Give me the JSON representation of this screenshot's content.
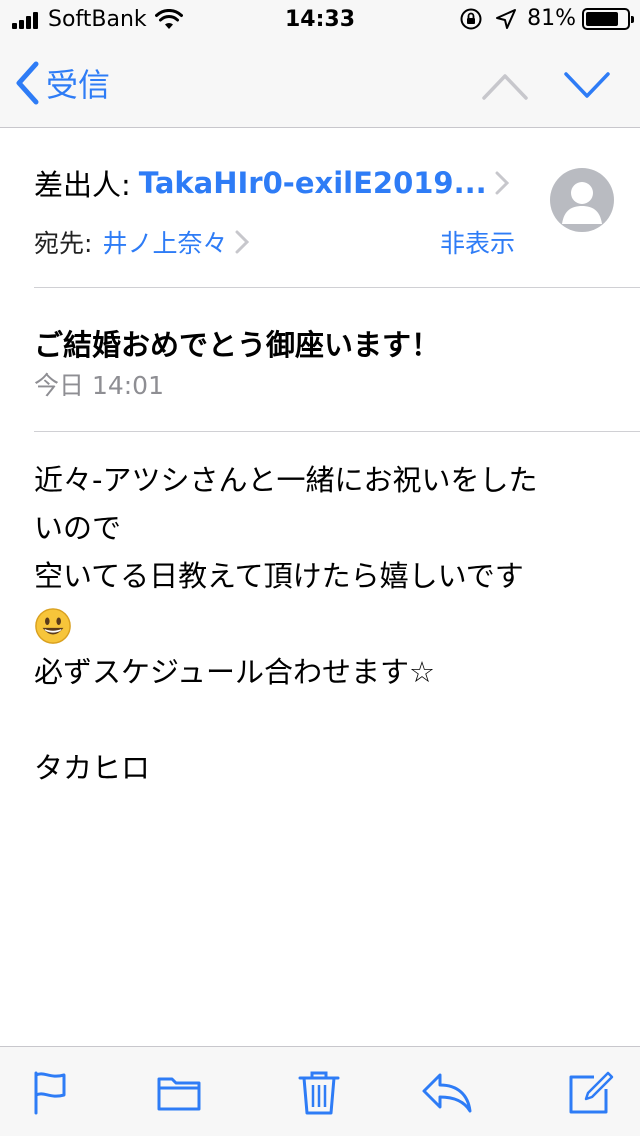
{
  "status_bar": {
    "carrier": "SoftBank",
    "time": "14:33",
    "battery_percent": "81%",
    "battery_level": 0.81
  },
  "nav": {
    "back_label": "受信"
  },
  "header": {
    "from_label": "差出人:",
    "from_value": "TakaHIr0-exilE2019...",
    "to_label": "宛先:",
    "to_value": "井ノ上奈々",
    "hide_label": "非表示"
  },
  "subject": "ご結婚おめでとう御座います！",
  "date": "今日 14:01",
  "body": {
    "line1": "近々-アツシさんと一緒にお祝いをした",
    "line2": "いので",
    "line3": "空いてる日教えて頂けたら嬉しいです",
    "line5": "必ずスケジュール合わせます☆",
    "line7": "タカヒロ"
  },
  "colors": {
    "accent": "#2e7cf6",
    "secondary_text": "#8e8e93",
    "bar_background": "#f7f7f7"
  },
  "icons": {
    "toolbar": [
      "flag-icon",
      "folder-icon",
      "trash-icon",
      "reply-icon",
      "compose-icon"
    ]
  }
}
